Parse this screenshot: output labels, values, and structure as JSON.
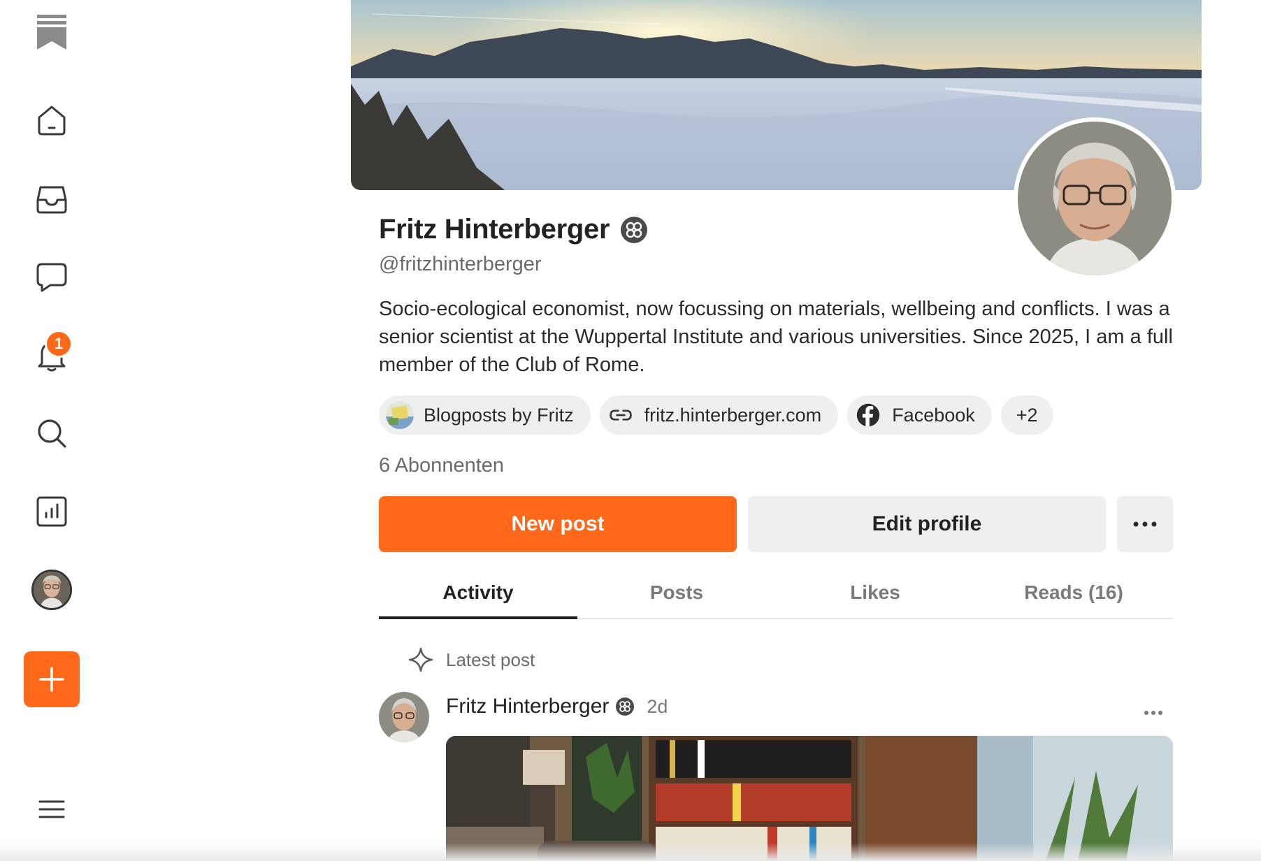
{
  "sidebar": {
    "items": [
      {
        "icon": "bookmark-logo-icon"
      },
      {
        "icon": "home-icon"
      },
      {
        "icon": "inbox-icon"
      },
      {
        "icon": "chat-icon"
      },
      {
        "icon": "bell-icon",
        "badge": "1"
      },
      {
        "icon": "search-icon"
      },
      {
        "icon": "chart-icon"
      },
      {
        "icon": "avatar"
      },
      {
        "icon": "plus-icon"
      },
      {
        "icon": "menu-icon"
      }
    ]
  },
  "profile": {
    "name": "Fritz Hinterberger",
    "handle": "@fritzhinterberger",
    "bio": "Socio-ecological economist, now focussing on materials, wellbeing and conflicts. I was a senior scientist at the Wuppertal Institute and various universities. Since 2025, I am a full member of the Club of Rome.",
    "links": [
      {
        "label": "Blogposts by Fritz",
        "icon": "blog-thumbnail-icon"
      },
      {
        "label": "fritz.hinterberger.com",
        "icon": "link-icon"
      },
      {
        "label": "Facebook",
        "icon": "facebook-icon"
      }
    ],
    "more_links": "+2",
    "subscribers": "6 Abonnenten"
  },
  "actions": {
    "new_post": "New post",
    "edit_profile": "Edit profile"
  },
  "tabs": [
    {
      "label": "Activity",
      "active": true
    },
    {
      "label": "Posts",
      "active": false
    },
    {
      "label": "Likes",
      "active": false
    },
    {
      "label": "Reads (16)",
      "active": false
    }
  ],
  "feed": {
    "section_label": "Latest post",
    "post": {
      "author": "Fritz Hinterberger",
      "time": "2d"
    }
  },
  "colors": {
    "accent": "#ff6719",
    "muted": "#6b6b6b",
    "chip_bg": "#efefef"
  }
}
